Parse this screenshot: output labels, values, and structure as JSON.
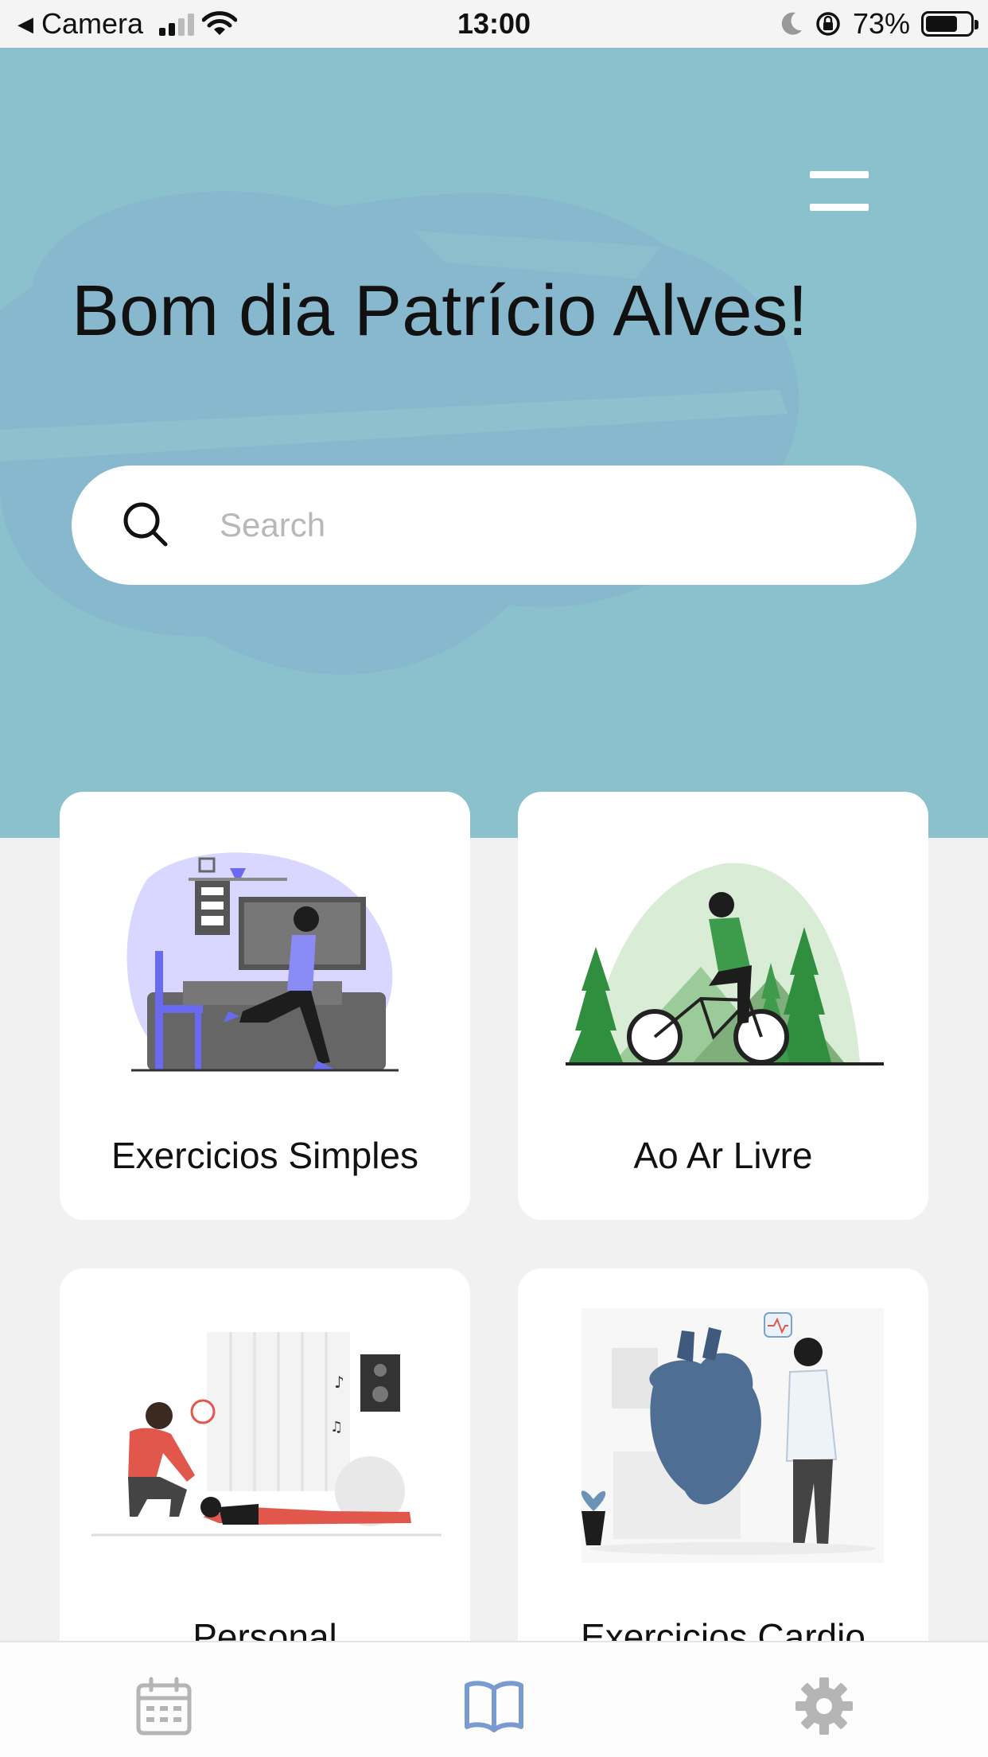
{
  "status_bar": {
    "back_label": "Camera",
    "time": "13:00",
    "battery": "73%",
    "battery_level": 0.73
  },
  "header": {
    "greeting": "Bom dia Patrício Alves!",
    "menu_icon": "hamburger-menu-icon"
  },
  "search": {
    "placeholder": "Search",
    "value": ""
  },
  "categories": [
    {
      "label": "Exercicios Simples",
      "illustration": "home-workout-illustration"
    },
    {
      "label": "Ao Ar Livre",
      "illustration": "cyclist-illustration"
    },
    {
      "label": "Personal",
      "illustration": "personal-trainer-illustration"
    },
    {
      "label": "Exercicios Cardio",
      "illustration": "heart-doctor-illustration"
    }
  ],
  "bottom_nav": [
    {
      "icon": "calendar-icon",
      "active": false
    },
    {
      "icon": "book-icon",
      "active": true
    },
    {
      "icon": "gear-icon",
      "active": false
    }
  ],
  "colors": {
    "hero": "#8bc0cd",
    "nav_active": "#7a9bd0",
    "nav_inactive": "#b5b5b5"
  }
}
